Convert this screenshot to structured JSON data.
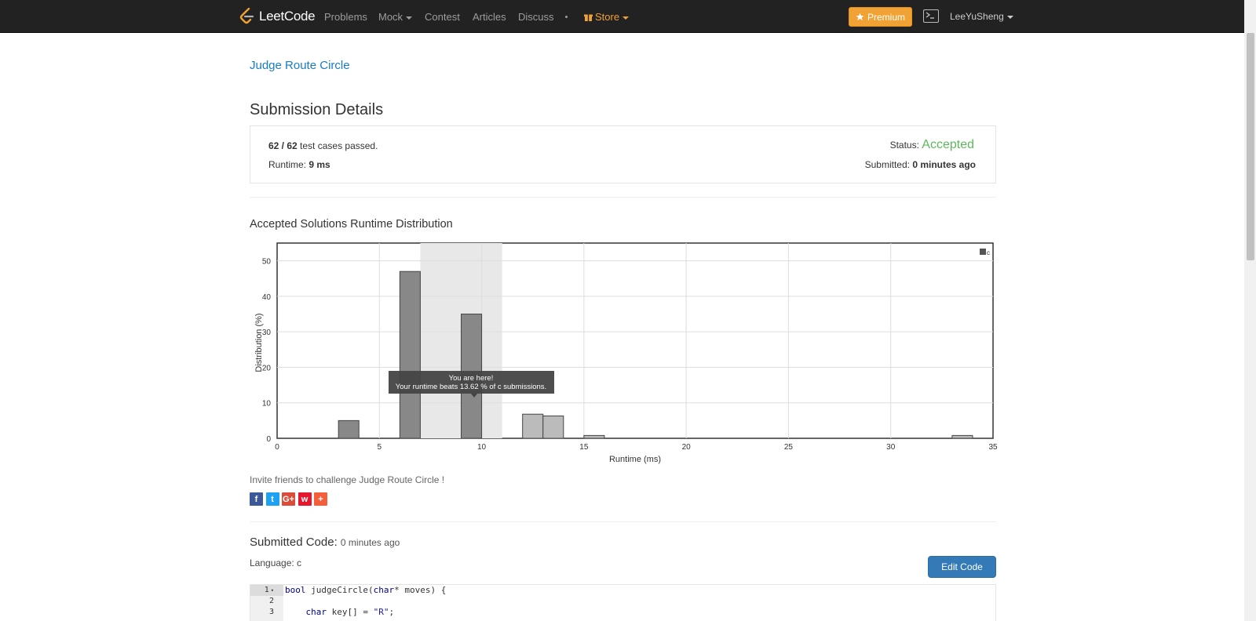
{
  "nav": {
    "brand": "LeetCode",
    "problems": "Problems",
    "mock": "Mock",
    "contest": "Contest",
    "articles": "Articles",
    "discuss": "Discuss",
    "store": "Store",
    "premium": "Premium",
    "user": "LeeYuSheng"
  },
  "colors": {
    "navbar_bg": "#222222",
    "link": "#1a7bc5",
    "accepted": "#5cb85c",
    "premium": "#f0a234",
    "edit_button": "#337ab7"
  },
  "problem_title": "Judge Route Circle",
  "details": {
    "heading": "Submission Details",
    "testcases_passed": "62 / 62",
    "testcases_suffix": "test cases passed.",
    "runtime_label": "Runtime:",
    "runtime_value": "9 ms",
    "status_label": "Status:",
    "status_value": "Accepted",
    "submitted_label": "Submitted:",
    "submitted_value": "0 minutes ago"
  },
  "chart_heading": "Accepted Solutions Runtime Distribution",
  "chart_data": {
    "type": "bar",
    "xlabel": "Runtime (ms)",
    "ylabel": "Distribution (%)",
    "xlim": [
      0,
      35
    ],
    "ylim": [
      0,
      55
    ],
    "xticks": [
      0,
      5,
      10,
      15,
      20,
      25,
      30,
      35
    ],
    "yticks": [
      0,
      10,
      20,
      30,
      40,
      50
    ],
    "grid": true,
    "legend": {
      "position": "top-right",
      "label": "c"
    },
    "highlight_range": [
      7,
      11
    ],
    "x": [
      3.5,
      6.5,
      9.5,
      12.5,
      13.5,
      15.5,
      33.5
    ],
    "values": [
      5.0,
      47.0,
      35.0,
      6.8,
      6.3,
      0.8,
      0.8
    ],
    "bar_colors": [
      "#888888",
      "#888888",
      "#888888",
      "#bbbbbb",
      "#bbbbbb",
      "#bbbbbb",
      "#bbbbbb"
    ],
    "tooltip": {
      "line1": "You are here!",
      "line2": "Your runtime beats 13.62 % of c submissions."
    }
  },
  "invite_text": "Invite friends to challenge Judge Route Circle !",
  "share_icons": [
    {
      "icon": "facebook-icon",
      "glyph": "f",
      "color": "#3b5998"
    },
    {
      "icon": "twitter-icon",
      "glyph": "t",
      "color": "#1da1f2"
    },
    {
      "icon": "google-plus-icon",
      "glyph": "G+",
      "color": "#dd4b39"
    },
    {
      "icon": "weibo-icon",
      "glyph": "w",
      "color": "#e6162d"
    },
    {
      "icon": "more-share-icon",
      "glyph": "+",
      "color": "#f65e3b"
    }
  ],
  "code": {
    "heading": "Submitted Code:",
    "time": "0 minutes ago",
    "language": "Language: c",
    "edit_button": "Edit Code",
    "lines": [
      "1",
      "2",
      "3"
    ],
    "line1_kw": "bool",
    "line1_rest": " judgeCircle(",
    "line1_kw2": "char",
    "line1_rest2": "* moves) {",
    "line3_kw": "char",
    "line3_rest": " key[] = ",
    "line3_str": "\"R\"",
    "line3_end": ";"
  }
}
